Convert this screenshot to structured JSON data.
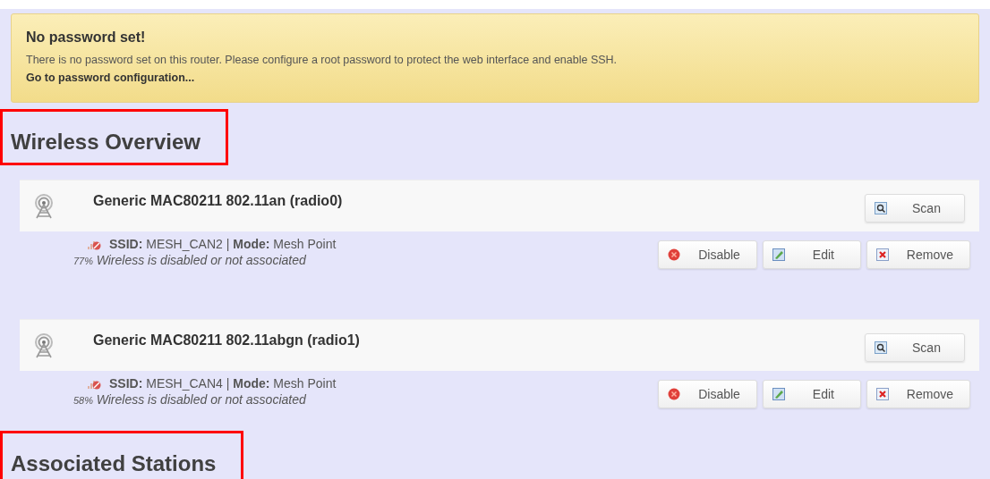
{
  "alert": {
    "title": "No password set!",
    "message": "There is no password set on this router. Please configure a root password to protect the web interface and enable SSH.",
    "link": "Go to password configuration..."
  },
  "sections": [
    {
      "heading": "Wireless Overview",
      "highlighted": true,
      "devices": [
        {
          "name": "Generic MAC80211 802.11an (radio0)",
          "header_buttons": [
            {
              "kind": "scan",
              "label": "Scan"
            }
          ],
          "networks": [
            {
              "info": "**SSID:** MESH_CAN2 | **Mode:** Mesh Point",
              "signal": "77%",
              "status": "Wireless is disabled or not associated",
              "buttons": [
                {
                  "kind": "disable",
                  "label": "Disable"
                },
                {
                  "kind": "edit",
                  "label": "Edit"
                },
                {
                  "kind": "remove",
                  "label": "Remove"
                }
              ]
            }
          ]
        },
        {
          "name": "Generic MAC80211 802.11abgn (radio1)",
          "header_buttons": [
            {
              "kind": "scan",
              "label": "Scan"
            }
          ],
          "networks": [
            {
              "info": "**SSID:** MESH_CAN4 | **Mode:** Mesh Point",
              "signal": "58%",
              "status": "Wireless is disabled or not associated",
              "buttons": [
                {
                  "kind": "disable",
                  "label": "Disable"
                },
                {
                  "kind": "edit",
                  "label": "Edit"
                },
                {
                  "kind": "remove",
                  "label": "Remove"
                }
              ]
            }
          ]
        }
      ]
    },
    {
      "heading": "Associated Stations",
      "highlighted": true
    }
  ]
}
